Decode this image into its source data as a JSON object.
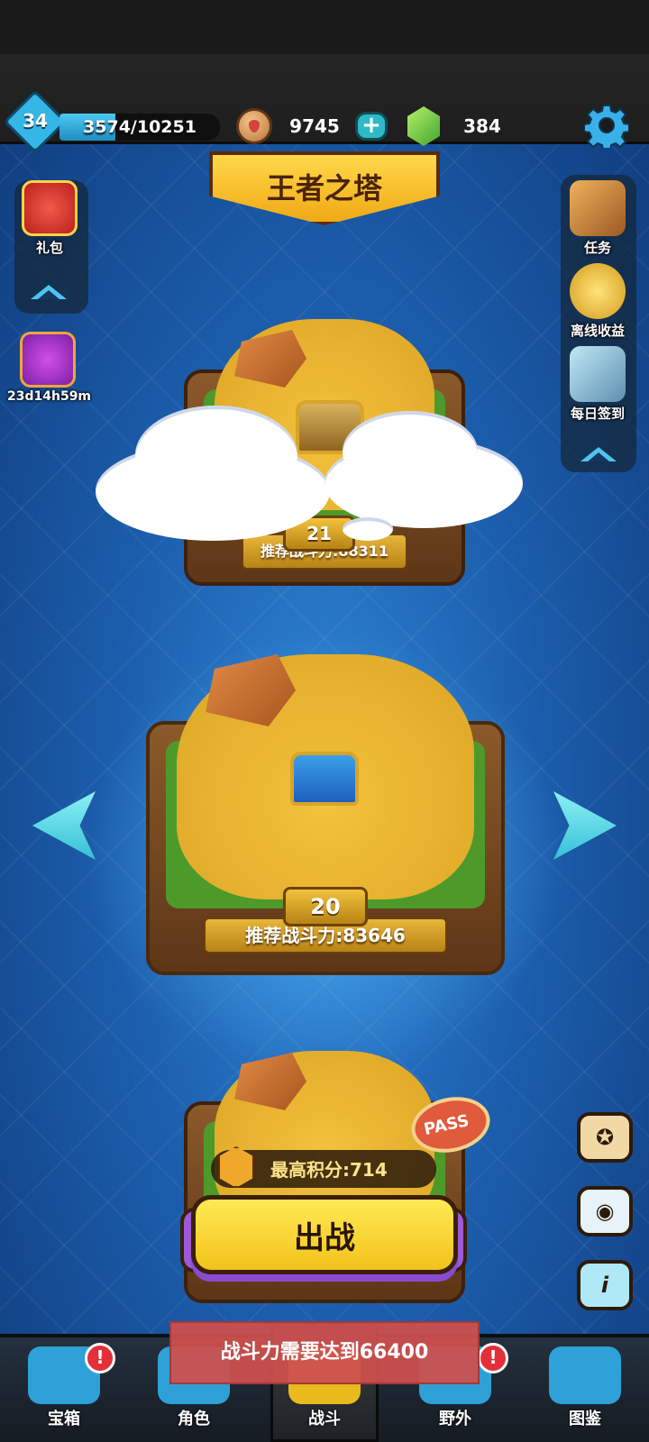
{
  "player": {
    "level": "34",
    "xp_text": "3574/10251",
    "xp_fraction": 0.349
  },
  "currency": {
    "coins": "9745",
    "gems": "384"
  },
  "title": "王者之塔",
  "left_side": {
    "gift_label": "礼包",
    "event_timer": "23d14h59m"
  },
  "right_side": {
    "items": [
      {
        "label": "任务",
        "icon": "quest-scroll-icon"
      },
      {
        "label": "离线收益",
        "icon": "offline-coin-icon"
      },
      {
        "label": "每日签到",
        "icon": "daily-checkin-icon"
      }
    ]
  },
  "floors": {
    "upper": {
      "level": "21",
      "power": "推荐战斗力:88311"
    },
    "current": {
      "level": "20",
      "power": "推荐战斗力:83646"
    }
  },
  "best_score": "最高积分:714",
  "pass_label": "PASS",
  "battle_button": "出战",
  "toast": "战斗力需要达到66400",
  "bottom_nav": [
    {
      "label": "宝箱",
      "icon": "chest-icon",
      "alert": "!"
    },
    {
      "label": "角色",
      "icon": "character-icon",
      "alert": ""
    },
    {
      "label": "战斗",
      "icon": "battle-icon",
      "alert": ""
    },
    {
      "label": "野外",
      "icon": "wild-castle-icon",
      "alert": "!"
    },
    {
      "label": "图鉴",
      "icon": "codex-book-icon",
      "alert": ""
    }
  ],
  "right_buttons": [
    {
      "icon": "medal-icon"
    },
    {
      "icon": "eye-icon"
    },
    {
      "icon": "info-icon",
      "glyph": "i"
    }
  ]
}
